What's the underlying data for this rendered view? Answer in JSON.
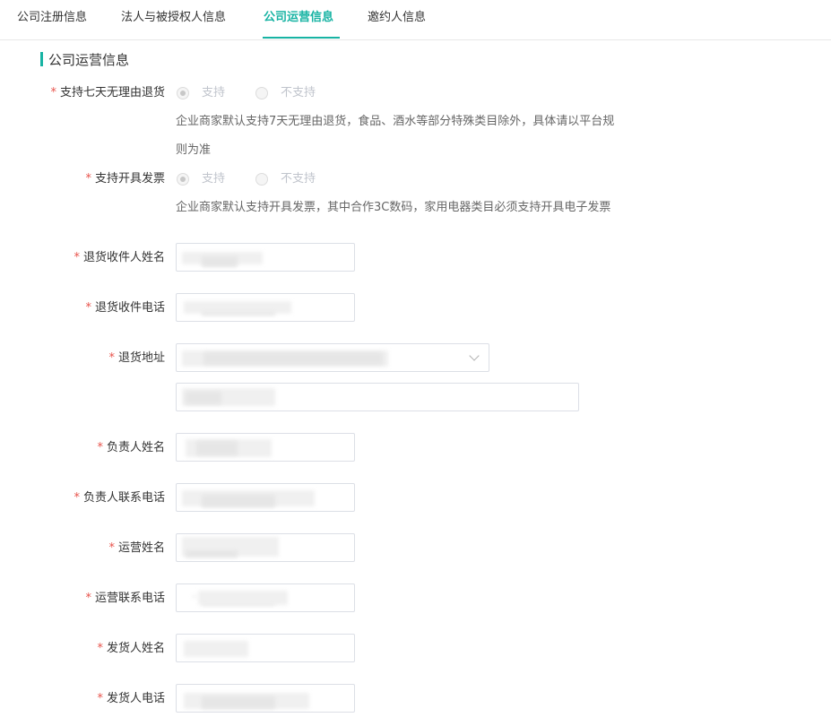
{
  "tabs": [
    {
      "label": "公司注册信息",
      "active": false
    },
    {
      "label": "法人与被授权人信息",
      "active": false
    },
    {
      "label": "公司运营信息",
      "active": true
    },
    {
      "label": "邀约人信息",
      "active": false
    }
  ],
  "section": {
    "title": "公司运营信息"
  },
  "colors": {
    "accent": "#17b3a3",
    "required": "#e8534b"
  },
  "form": {
    "return_policy": {
      "label": "支持七天无理由退货",
      "options": [
        "支持",
        "不支持"
      ],
      "selected": "支持",
      "hint_line1": "企业商家默认支持7天无理由退货，食品、酒水等部分特殊类目除外，具体请以平台规",
      "hint_line2": "则为准"
    },
    "invoice": {
      "label": "支持开具发票",
      "options": [
        "支持",
        "不支持"
      ],
      "selected": "支持",
      "hint": "企业商家默认支持开具发票，其中合作3C数码，家用电器类目必须支持开具电子发票"
    },
    "return_name": {
      "label": "退货收件人姓名"
    },
    "return_phone": {
      "label": "退货收件电话"
    },
    "return_address": {
      "label": "退货地址"
    },
    "manager_name": {
      "label": "负责人姓名"
    },
    "manager_phone": {
      "label": "负责人联系电话"
    },
    "ops_name": {
      "label": "运营姓名"
    },
    "ops_phone": {
      "label": "运营联系电话"
    },
    "shipper_name": {
      "label": "发货人姓名"
    },
    "shipper_phone": {
      "label": "发货人电话"
    }
  }
}
